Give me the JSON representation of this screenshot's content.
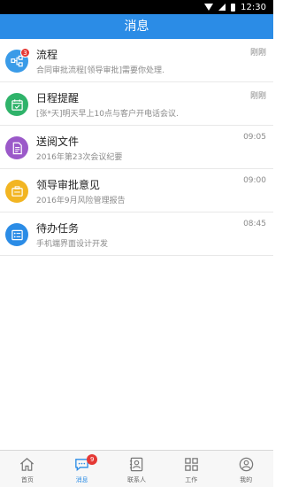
{
  "status_bar": {
    "time": "12:30"
  },
  "header": {
    "title": "消息"
  },
  "messages": [
    {
      "title": "流程",
      "subtitle": "合同审批流程[领导审批]需要你处理.",
      "time": "刚刚",
      "badge": "3",
      "icon": "flow-icon",
      "color": "#3a9be8"
    },
    {
      "title": "日程提醒",
      "subtitle": "[张*天]明天早上10点与客户开电话会议.",
      "time": "刚刚",
      "icon": "calendar-icon",
      "color": "#2fb36a"
    },
    {
      "title": "送阅文件",
      "subtitle": "2016年第23次会议纪要",
      "time": "09:05",
      "icon": "document-icon",
      "color": "#9b59c9"
    },
    {
      "title": "领导审批意见",
      "subtitle": "2016年9月风险管理报告",
      "time": "09:00",
      "icon": "approval-icon",
      "color": "#f2b522"
    },
    {
      "title": "待办任务",
      "subtitle": "手机端界面设计开发",
      "time": "08:45",
      "icon": "task-list-icon",
      "color": "#2b8ce6"
    }
  ],
  "tabs": [
    {
      "label": "首页",
      "icon": "home-icon"
    },
    {
      "label": "消息",
      "icon": "chat-icon",
      "badge": "9",
      "active": true
    },
    {
      "label": "联系人",
      "icon": "contacts-icon"
    },
    {
      "label": "工作",
      "icon": "grid-icon"
    },
    {
      "label": "我的",
      "icon": "profile-icon"
    }
  ],
  "colors": {
    "primary": "#2b8ce6",
    "badge": "#e53935"
  }
}
